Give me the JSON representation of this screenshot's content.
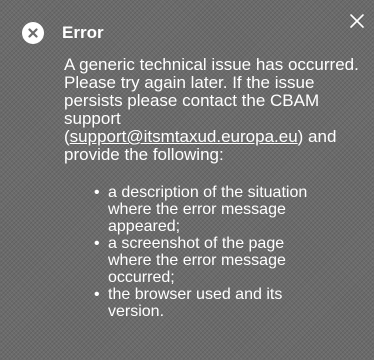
{
  "toast": {
    "title": "Error",
    "message_intro": "A generic technical issue has occurred. Please try again later. If the issue persists please contact the CBAM support (",
    "support_email": "support@itsmtaxud.europa.eu",
    "message_outro": ") and provide the following:",
    "items": [
      "a description of the situation where the error message appeared;",
      "a screenshot of the page where the error message occurred;",
      "the browser used and its version."
    ]
  },
  "icons": {
    "status": "error-circle-x-icon",
    "close": "close-icon"
  },
  "colors": {
    "background": "#6b6b6b",
    "text": "#ffffff"
  }
}
